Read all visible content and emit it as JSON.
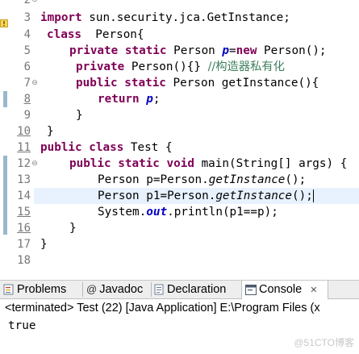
{
  "editor": {
    "line_numbers": [
      "2",
      "3",
      "4",
      "5",
      "6",
      "7",
      "8",
      "9",
      "10",
      "11",
      "12",
      "13",
      "14",
      "15",
      "16",
      "17",
      "18"
    ],
    "lines": {
      "l3": {
        "kw": "import",
        "rest": " sun.security.jca.GetInstance;"
      },
      "l4": {
        "kw": "class",
        "rest": "  Person{"
      },
      "l5": {
        "kw1": "private",
        "kw2": "static",
        "mid": " Person ",
        "var": "p",
        "eq": "=",
        "kw3": "new",
        "rest": " Person();"
      },
      "l6": {
        "kw": "private",
        "rest": " Person(){} ",
        "comment": "//构造器私有化"
      },
      "l7": {
        "kw1": "public",
        "kw2": "static",
        "rest": " Person getInstance(){"
      },
      "l8": {
        "kw": "return",
        "var": "p",
        "rest": ";"
      },
      "l9": {
        "rest": "}"
      },
      "l10": {
        "rest": "}"
      },
      "l11": {
        "kw1": "public",
        "kw2": "class",
        "rest": " Test {"
      },
      "l12": {
        "kw1": "public",
        "kw2": "static",
        "kw3": "void",
        "rest": " main(String[] args) {"
      },
      "l13": {
        "pre": "Person p=Person.",
        "call": "getInstance",
        "post": "();"
      },
      "l14": {
        "pre": "Person p1=Person.",
        "call": "getInstance",
        "post": "();"
      },
      "l15": {
        "pre": "System.",
        "field": "out",
        "post": ".println(p1==p);"
      },
      "l16": {
        "rest": "}"
      },
      "l17": {
        "rest": "}"
      }
    }
  },
  "panel": {
    "tabs": {
      "problems": "Problems",
      "javadoc": "Javadoc",
      "declaration": "Declaration",
      "console": "Console",
      "close": "✕"
    },
    "status": "<terminated> Test (22) [Java Application] E:\\Program Files (x",
    "output": "true",
    "watermark": "@51CTO博客"
  }
}
